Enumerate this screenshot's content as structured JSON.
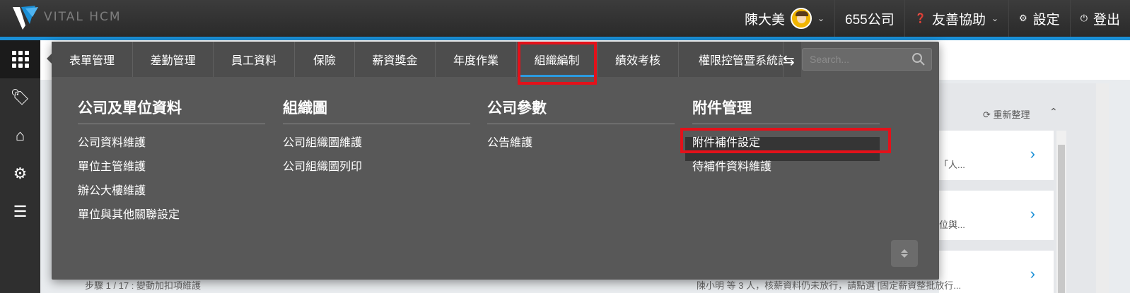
{
  "app": {
    "brand": "VITAL HCM"
  },
  "header": {
    "user_name": "陳大美",
    "company": "655公司",
    "help": "友善協助",
    "settings": "設定",
    "logout": "登出"
  },
  "menu": {
    "tabs": [
      {
        "label": "表單管理"
      },
      {
        "label": "差勤管理"
      },
      {
        "label": "員工資料"
      },
      {
        "label": "保險"
      },
      {
        "label": "薪資獎金"
      },
      {
        "label": "年度作業"
      },
      {
        "label": "組織編制"
      },
      {
        "label": "績效考核"
      },
      {
        "label": "權限控管暨系統設定"
      }
    ],
    "active_tab": "組織編制",
    "search_placeholder": "Search...",
    "columns": [
      {
        "title": "公司及單位資料",
        "items": [
          "公司資料維護",
          "單位主管維護",
          "辦公大樓維護",
          "單位與其他關聯設定"
        ]
      },
      {
        "title": "組織圖",
        "items": [
          "公司組織圖維護",
          "公司組織圖列印"
        ]
      },
      {
        "title": "公司參數",
        "items": [
          "公告維護"
        ]
      },
      {
        "title": "附件管理",
        "items": [
          "附件補件設定",
          "待補件資料維護"
        ]
      }
    ],
    "selected_item": "附件補件設定"
  },
  "background": {
    "refresh_label": "重新整理",
    "card1_text": "「人...",
    "card2_text": "位與...",
    "bottom_left": "步驟 1 / 17 : 變動加扣項維護",
    "bottom_right": "陳小明 等 3 人，核薪資料仍未放行，請點選 [固定薪資整批放行..."
  },
  "colors": {
    "accent": "#1a8fd6",
    "highlight": "#e3111a",
    "menu_bg": "#585858"
  }
}
